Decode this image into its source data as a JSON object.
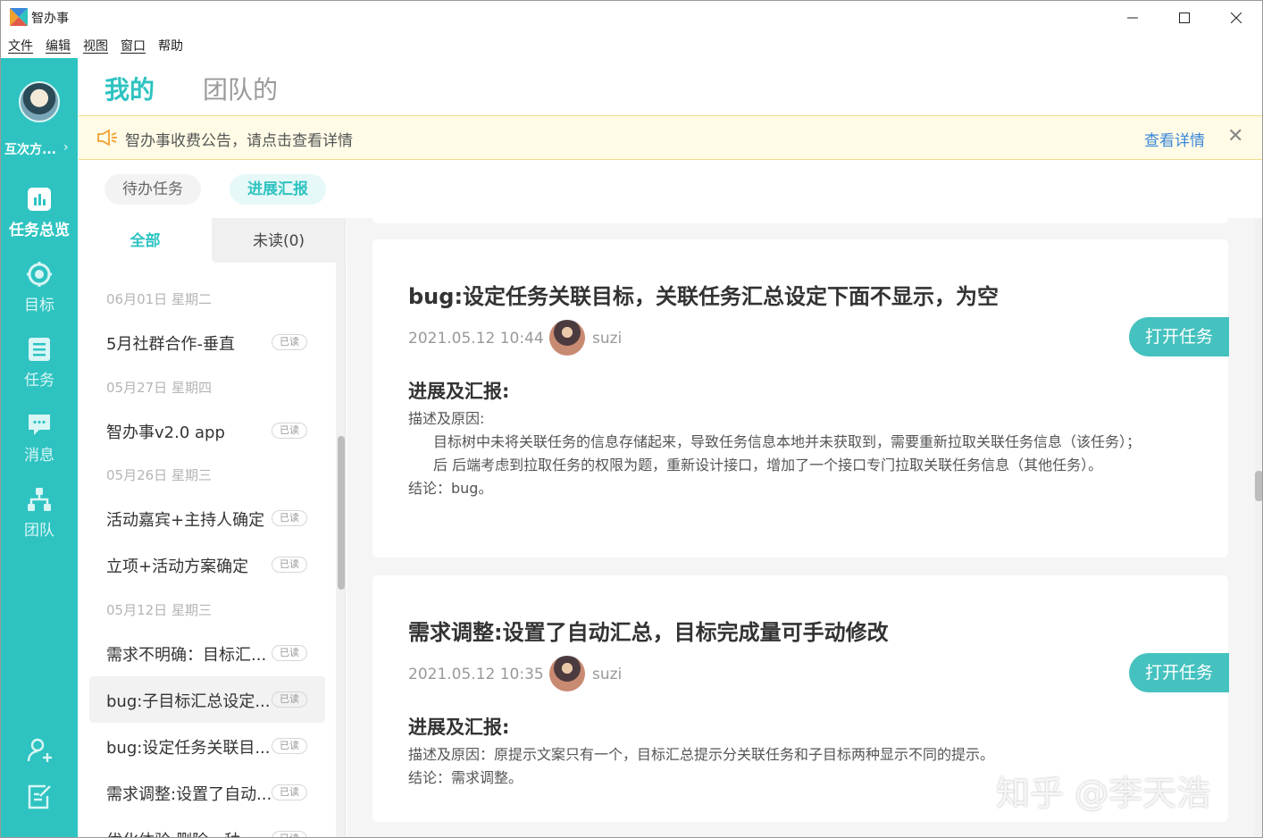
{
  "window": {
    "title": "智办事",
    "minimize": "—",
    "maximize": "☐",
    "close": "✕"
  },
  "menubar": [
    "文件",
    "编辑",
    "视图",
    "窗口",
    "帮助"
  ],
  "user": {
    "name": "互次方...",
    "chevron": "›"
  },
  "rail": [
    {
      "label": "任务总览",
      "icon": "bar-chart-icon",
      "active": true
    },
    {
      "label": "目标",
      "icon": "target-icon",
      "active": false
    },
    {
      "label": "任务",
      "icon": "task-list-icon",
      "active": false
    },
    {
      "label": "消息",
      "icon": "message-icon",
      "active": false
    },
    {
      "label": "团队",
      "icon": "team-tree-icon",
      "active": false
    }
  ],
  "rail_bottom": [
    {
      "icon": "add-person-icon"
    },
    {
      "icon": "edit-note-icon"
    }
  ],
  "top_tabs": {
    "mine": "我的",
    "team": "团队的"
  },
  "notice": {
    "text": "智办事收费公告，请点击查看详情",
    "link": "查看详情",
    "close": "✕"
  },
  "sub_tabs": {
    "todo": "待办任务",
    "progress": "进展汇报"
  },
  "filters": {
    "all": "全部",
    "unread": "未读(0)"
  },
  "list": {
    "badge": "已读",
    "groups": [
      {
        "date": "06月01日 星期二",
        "items": [
          "5月社群合作-垂直"
        ]
      },
      {
        "date": "05月27日 星期四",
        "items": [
          "智办事v2.0 app"
        ]
      },
      {
        "date": "05月26日 星期三",
        "items": [
          "活动嘉宾+主持人确定",
          "立项+活动方案确定"
        ]
      },
      {
        "date": "05月12日 星期三",
        "items": [
          "需求不明确：目标汇...",
          "bug:子目标汇总设定...",
          "bug:设定任务关联目...",
          "需求调整:设置了自动...",
          "优化体验:删除一种..."
        ]
      }
    ]
  },
  "cards": [
    {
      "title": "bug:设定任务关联目标，关联任务汇总设定下面不显示，为空",
      "time": "2021.05.12 10:44",
      "user": "suzi",
      "button": "打开任务",
      "section": "进展及汇报:",
      "lines": [
        "描述及原因:",
        "目标树中未将关联任务的信息存储起来，导致任务信息本地并未获取到，需要重新拉取关联任务信息（该任务）；",
        "后 后端考虑到拉取任务的权限为题，重新设计接口，增加了一个接口专门拉取关联任务信息（其他任务）。",
        "结论：bug。"
      ]
    },
    {
      "title": "需求调整:设置了自动汇总，目标完成量可手动修改",
      "time": "2021.05.12 10:35",
      "user": "suzi",
      "button": "打开任务",
      "section": "进展及汇报:",
      "lines": [
        "描述及原因：原提示文案只有一个，目标汇总提示分关联任务和子目标两种显示不同的提示。",
        "结论：需求调整。"
      ]
    }
  ],
  "watermark": "知乎 @李天浩",
  "colors": {
    "accent": "#2ec3c1",
    "button": "#45c2bf",
    "notice_bg": "#fffbe6",
    "link": "#3a86d8"
  }
}
